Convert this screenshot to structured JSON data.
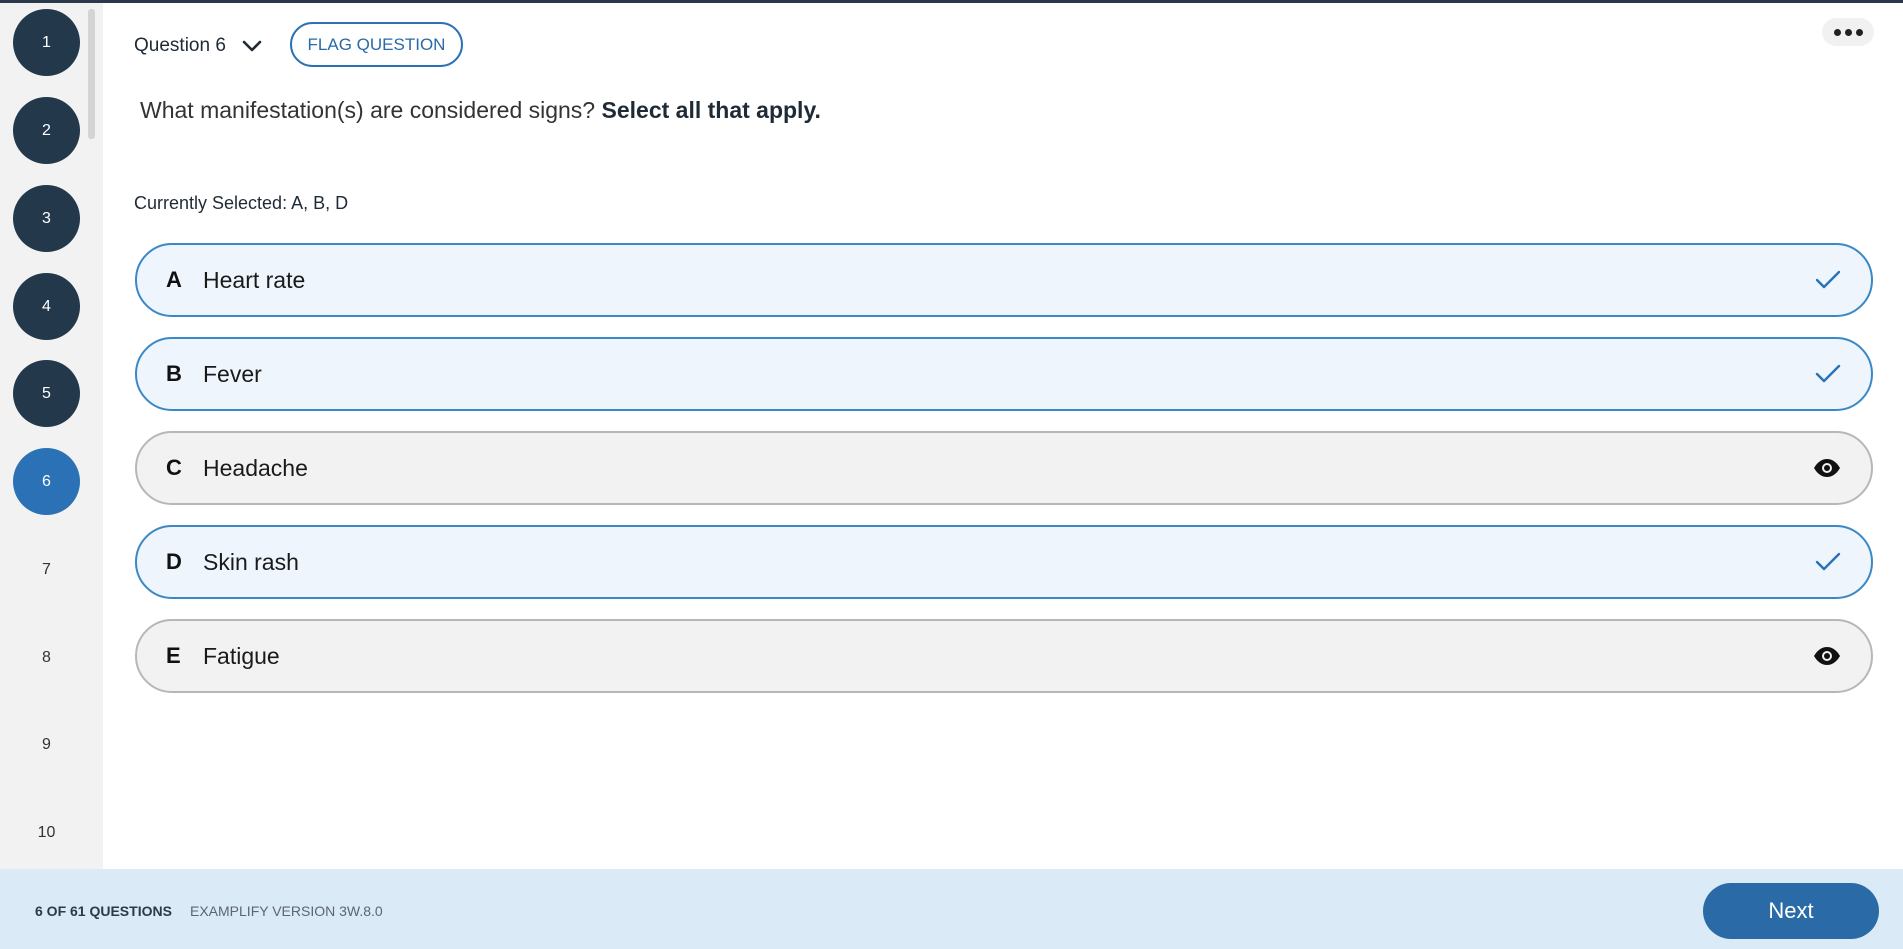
{
  "sidebar": {
    "questions": [
      {
        "label": "1",
        "state": "done"
      },
      {
        "label": "2",
        "state": "done"
      },
      {
        "label": "3",
        "state": "done"
      },
      {
        "label": "4",
        "state": "done"
      },
      {
        "label": "5",
        "state": "done"
      },
      {
        "label": "6",
        "state": "current"
      },
      {
        "label": "7",
        "state": "todo"
      },
      {
        "label": "8",
        "state": "todo"
      },
      {
        "label": "9",
        "state": "todo"
      },
      {
        "label": "10",
        "state": "todo"
      }
    ]
  },
  "header": {
    "question_label": "Question 6",
    "flag_label": "FLAG QUESTION"
  },
  "question": {
    "prompt": "What manifestation(s) are considered signs?",
    "instruction": "Select all that apply."
  },
  "current_selection": "Currently Selected: A, B, D",
  "options": [
    {
      "letter": "A",
      "text": "Heart rate",
      "selected": true,
      "icon": "check-icon"
    },
    {
      "letter": "B",
      "text": "Fever",
      "selected": true,
      "icon": "check-icon"
    },
    {
      "letter": "C",
      "text": "Headache",
      "selected": false,
      "icon": "eye-icon"
    },
    {
      "letter": "D",
      "text": "Skin rash",
      "selected": true,
      "icon": "check-icon"
    },
    {
      "letter": "E",
      "text": "Fatigue",
      "selected": false,
      "icon": "eye-icon"
    }
  ],
  "footer": {
    "count": "6 OF 61 QUESTIONS",
    "version": "EXAMPLIFY VERSION 3W.8.0",
    "next_label": "Next"
  },
  "colors": {
    "accent": "#2a72b5",
    "done": "#24384c",
    "footer_bg": "#dbeaf7"
  }
}
